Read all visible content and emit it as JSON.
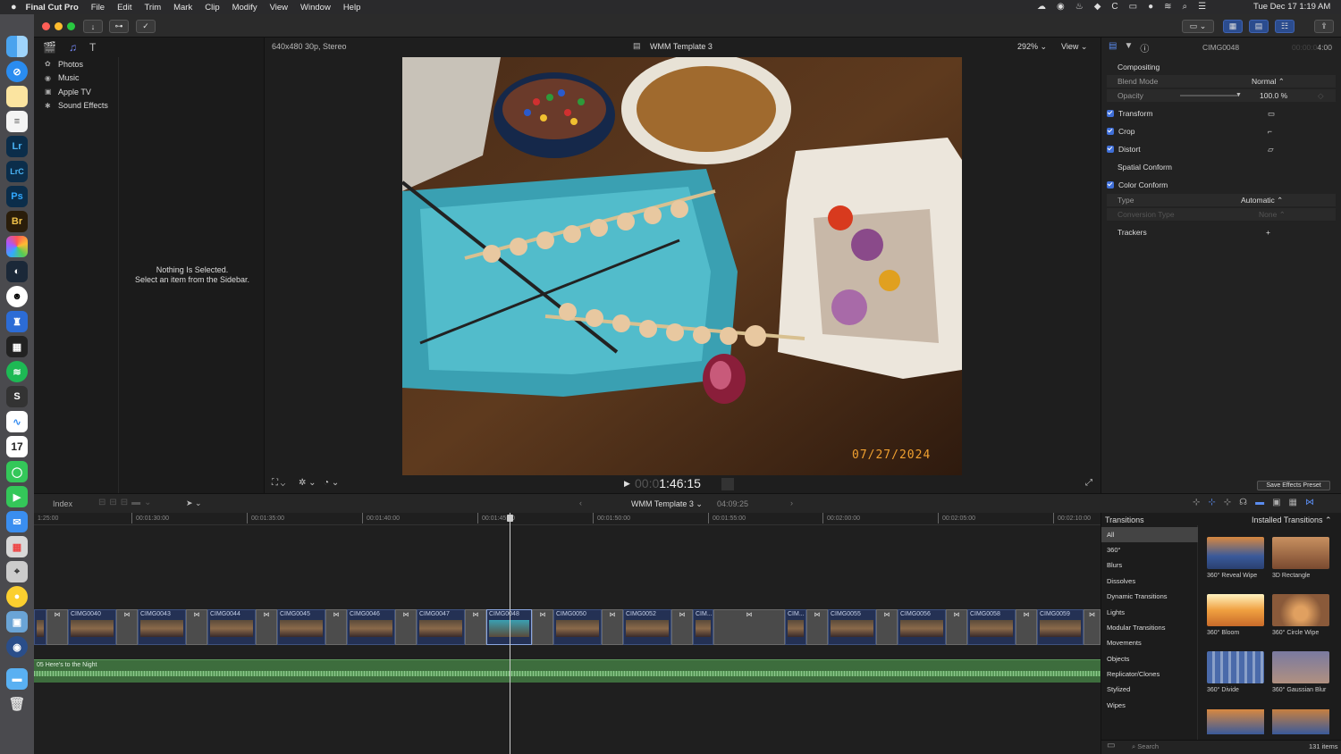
{
  "menubar": {
    "app": "Final Cut Pro",
    "items": [
      "File",
      "Edit",
      "Trim",
      "Mark",
      "Clip",
      "Modify",
      "View",
      "Window",
      "Help"
    ],
    "clock": "Tue Dec 17 1:19 AM"
  },
  "dock": {
    "apps": [
      {
        "name": "finder",
        "label": ""
      },
      {
        "name": "safari",
        "label": ""
      },
      {
        "name": "notes",
        "label": ""
      },
      {
        "name": "reminders",
        "label": ""
      },
      {
        "name": "lightroom",
        "label": "Lr"
      },
      {
        "name": "lightroom-classic",
        "label": "LrC"
      },
      {
        "name": "photoshop",
        "label": "Ps"
      },
      {
        "name": "bridge",
        "label": "Br"
      },
      {
        "name": "photos",
        "label": ""
      },
      {
        "name": "steam",
        "label": ""
      },
      {
        "name": "app",
        "label": ""
      },
      {
        "name": "instruments",
        "label": ""
      },
      {
        "name": "final-cut",
        "label": ""
      },
      {
        "name": "spotify",
        "label": ""
      },
      {
        "name": "app2",
        "label": ""
      },
      {
        "name": "freeform",
        "label": ""
      },
      {
        "name": "calendar",
        "label": "17"
      },
      {
        "name": "messages",
        "label": ""
      },
      {
        "name": "facetime",
        "label": ""
      },
      {
        "name": "mail",
        "label": ""
      },
      {
        "name": "launchpad",
        "label": ""
      },
      {
        "name": "app3",
        "label": ""
      },
      {
        "name": "tips",
        "label": ""
      },
      {
        "name": "preview",
        "label": ""
      },
      {
        "name": "app4",
        "label": ""
      },
      {
        "name": "folder",
        "label": ""
      },
      {
        "name": "trash",
        "label": ""
      }
    ]
  },
  "sidebar": {
    "items": [
      "Photos",
      "Music",
      "Apple TV",
      "Sound Effects"
    ]
  },
  "browser": {
    "empty_line1": "Nothing Is Selected.",
    "empty_line2": "Select an item from the Sidebar."
  },
  "viewer": {
    "format": "640x480 30p, Stereo",
    "project": "WMM Template 3",
    "zoom": "292%",
    "view": "View",
    "timecode_dim": "00:0",
    "timecode": "1:46:15",
    "date_stamp": "07/27/2024"
  },
  "inspector": {
    "clip": "CIMG0048",
    "duration_dim": "00:00:0",
    "duration": "4:00",
    "compositing": "Compositing",
    "blend_mode_label": "Blend Mode",
    "blend_mode": "Normal",
    "opacity_label": "Opacity",
    "opacity": "100.0",
    "opacity_unit": "%",
    "transform": "Transform",
    "crop": "Crop",
    "distort": "Distort",
    "spatial_conform": "Spatial Conform",
    "color_conform": "Color Conform",
    "type_label": "Type",
    "type_value": "Automatic",
    "conversion_label": "Conversion Type",
    "conversion_value": "None",
    "trackers": "Trackers",
    "save_preset": "Save Effects Preset"
  },
  "timeline": {
    "index": "Index",
    "project": "WMM Template 3",
    "duration": "04:09:25",
    "ruler": [
      "1:25:00",
      "00:01:30:00",
      "00:01:35:00",
      "00:01:40:00",
      "00:01:45:00",
      "00:01:50:00",
      "00:01:55:00",
      "00:02:00:00",
      "00:02:05:00",
      "00:02:10:00"
    ],
    "clips": [
      "",
      "CIMG0040",
      "CIMG0043",
      "CIMG0044",
      "CIMG0045",
      "CIMG0046",
      "CIMG0047",
      "CIMG0048",
      "CIMG0050",
      "CIMG0052",
      "CIM...",
      "",
      "CIM...",
      "CIMG0055",
      "CIMG0056",
      "CIMG0058",
      "CIMG0059"
    ],
    "audio": "05 Here's to the Night"
  },
  "transitions": {
    "header": "Transitions",
    "installed": "Installed Transitions",
    "categories": [
      "All",
      "360°",
      "Blurs",
      "Dissolves",
      "Dynamic Transitions",
      "Lights",
      "Modular Transitions",
      "Movements",
      "Objects",
      "Replicator/Clones",
      "Stylized",
      "Wipes"
    ],
    "items": [
      "360° Reveal Wipe",
      "3D Rectangle",
      "360° Bloom",
      "360° Circle Wipe",
      "360° Divide",
      "360° Gaussian Blur"
    ],
    "search": "Search",
    "count": "131 items"
  }
}
